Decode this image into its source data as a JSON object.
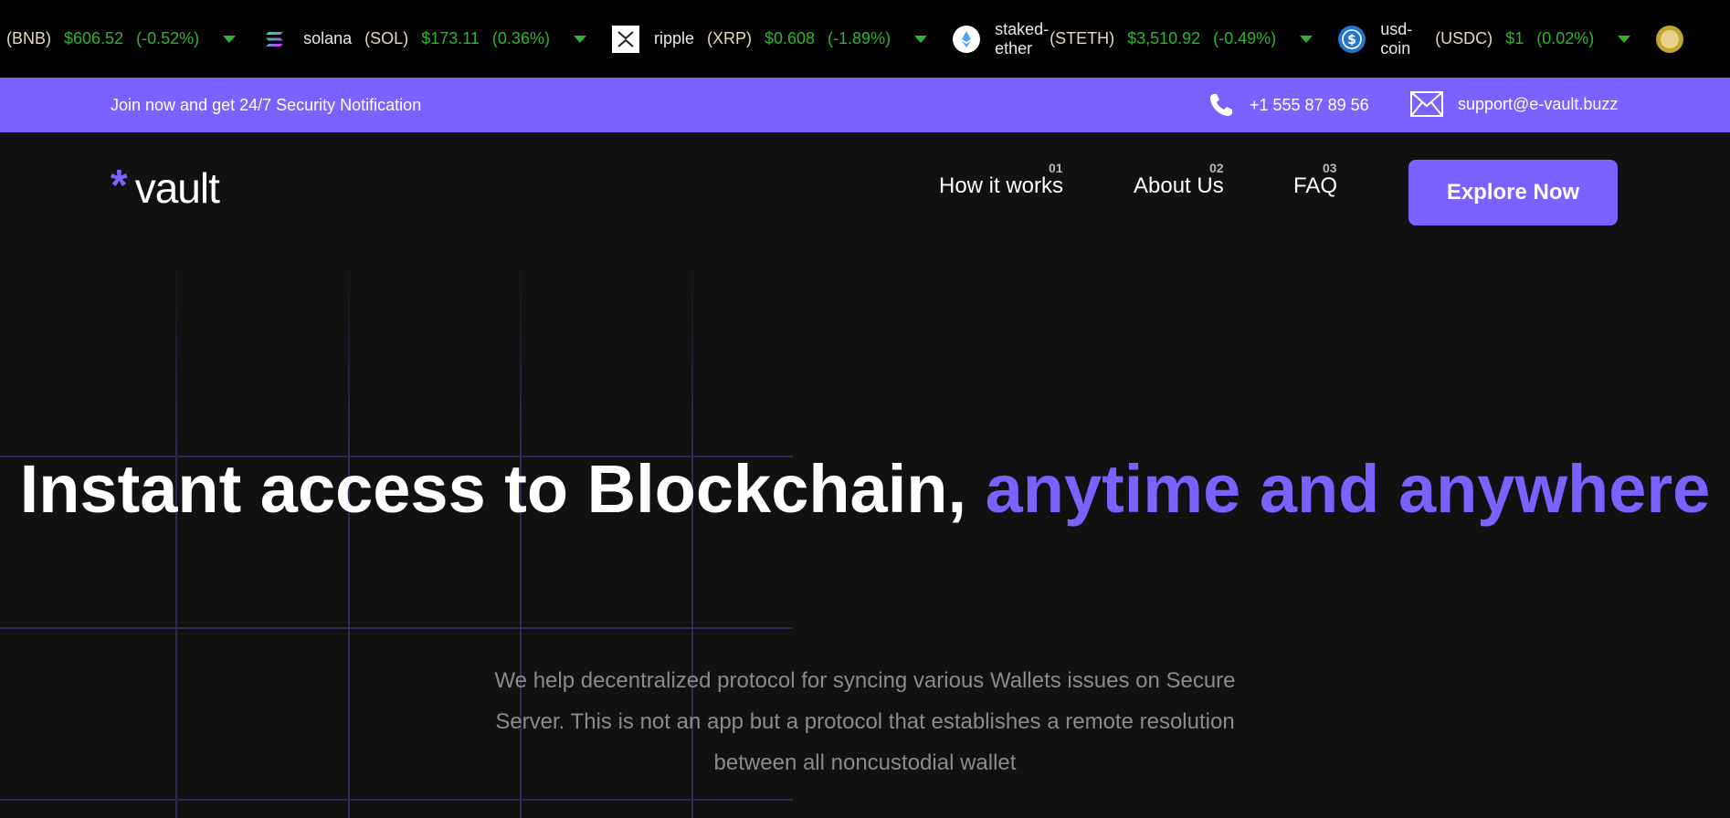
{
  "ticker": {
    "partial_first": {
      "symbol": "(BNB)",
      "price": "$606.52",
      "change": "(-0.52%)"
    },
    "items": [
      {
        "name": "solana",
        "symbol": "(SOL)",
        "price": "$173.11",
        "change": "(0.36%)",
        "icon": "solana-icon"
      },
      {
        "name": "ripple",
        "symbol": "(XRP)",
        "price": "$0.608",
        "change": "(-1.89%)",
        "icon": "xrp-icon"
      },
      {
        "name": "staked-ether",
        "symbol": "(STETH)",
        "price": "$3,510.92",
        "change": "(-0.49%)",
        "icon": "steth-icon"
      },
      {
        "name": "usd-coin",
        "symbol": "(USDC)",
        "price": "$1",
        "change": "(0.02%)",
        "icon": "usdc-icon"
      }
    ],
    "positive_color": "#2fb32f"
  },
  "notification": {
    "text": "Join now and get 24/7 Security Notification",
    "phone": "+1 555 87 89 56",
    "email": "support@e-vault.buzz"
  },
  "header": {
    "logo_text": "vault",
    "nav": [
      {
        "num": "01",
        "label": "How it works"
      },
      {
        "num": "02",
        "label": "About Us"
      },
      {
        "num": "03",
        "label": "FAQ"
      }
    ],
    "cta": "Explore Now"
  },
  "hero": {
    "title_main": "Instant access to Blockchain, ",
    "title_accent": "anytime and anywhere",
    "subtitle": "We help decentralized protocol for syncing various Wallets issues on Secure Server. This is not an app but a protocol that establishes a remote resolution between all noncustodial wallet"
  },
  "colors": {
    "accent": "#7b61ff",
    "background": "#111111",
    "ticker_bg": "#000000"
  }
}
